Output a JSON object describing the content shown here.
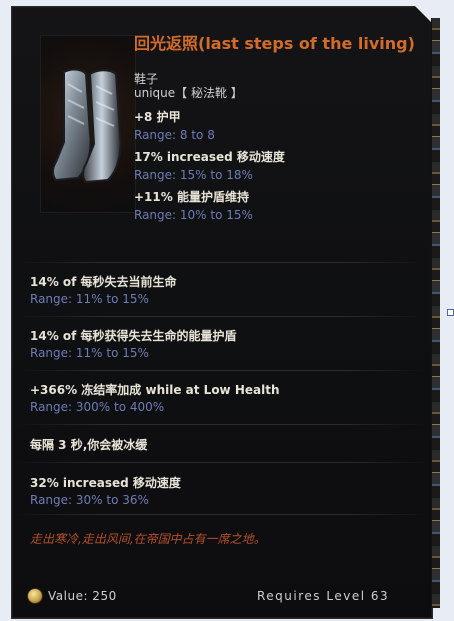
{
  "item": {
    "title": "回光返照(last steps of the living)",
    "type": "鞋子",
    "rarity": "unique【 秘法靴 】",
    "implicits": [
      {
        "text": "+8 护甲",
        "range": "Range: 8 to 8"
      },
      {
        "text": "17% increased 移动速度",
        "range": "Range: 15% to 18%"
      },
      {
        "text": "+11% 能量护盾维持",
        "range": "Range: 10% to 15%"
      }
    ],
    "affixes": [
      {
        "text": "14% of 每秒失去当前生命",
        "range": "Range: 11% to 15%"
      },
      {
        "text": "14% of 每秒获得失去生命的能量护盾",
        "range": "Range: 11% to 15%"
      },
      {
        "text": "+366% 冻结率加成 while at Low Health",
        "range": "Range: 300% to 400%"
      },
      {
        "text": "每隔 3 秒,你会被冰缓",
        "range": ""
      },
      {
        "text": "32% increased 移动速度",
        "range": "Range: 30% to 36%"
      }
    ],
    "lore": "走出寒冷,走出风间,在帝国中占有一席之地。",
    "footer": {
      "value_label": "Value: 250",
      "requires_level": "Requires Level 63"
    }
  },
  "colors": {
    "title": "#d36b2b",
    "range": "#6f7cb6",
    "lore": "#b6512a"
  },
  "icons": {
    "item_image": "boots-icon",
    "currency": "gold-coin-icon"
  }
}
